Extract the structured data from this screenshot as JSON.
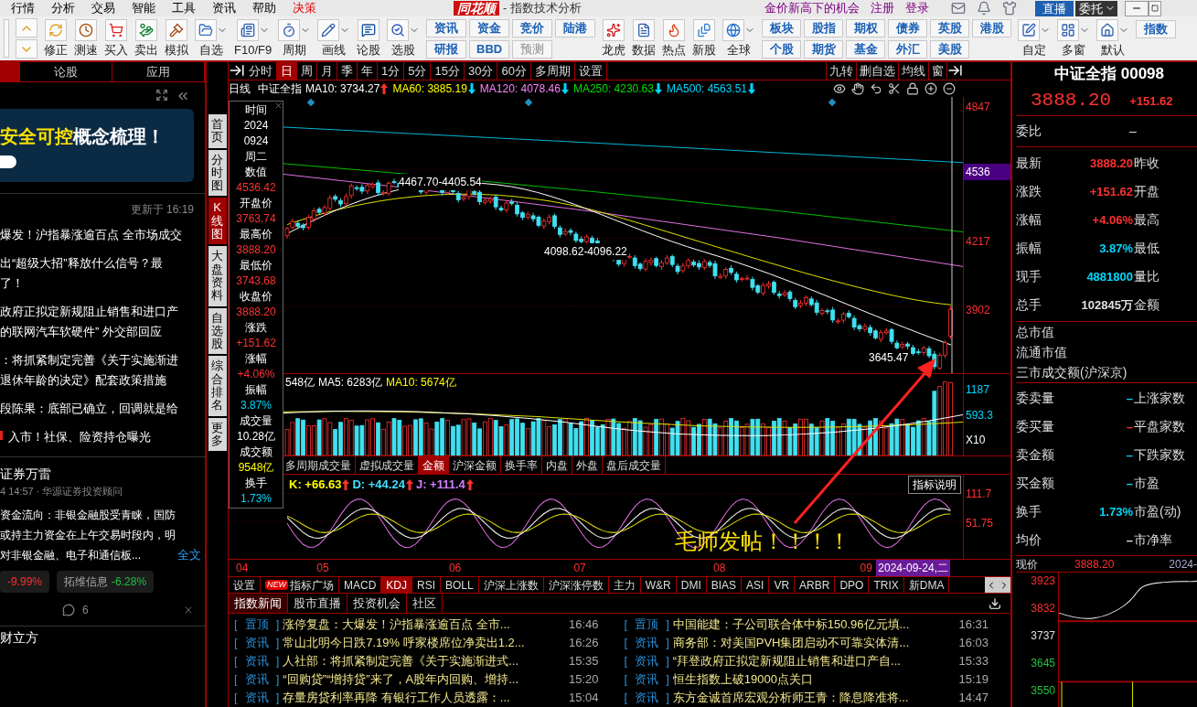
{
  "menu_bar": {
    "menus": [
      {
        "label": "行情",
        "highlight": false
      },
      {
        "label": "分析",
        "highlight": false
      },
      {
        "label": "交易",
        "highlight": false
      },
      {
        "label": "智能",
        "highlight": false
      },
      {
        "label": "工具",
        "highlight": false
      },
      {
        "label": "资讯",
        "highlight": false
      },
      {
        "label": "帮助",
        "highlight": false
      },
      {
        "label": "决策",
        "highlight": true
      }
    ],
    "logo": "同花顺",
    "window_title": "- 指数技术分析",
    "promo": "金价新高下的机会",
    "links": [
      "注册",
      "登录"
    ],
    "buttons": [
      {
        "label": "直播",
        "kind": "live"
      },
      {
        "label": "委托",
        "kind": "trade"
      }
    ]
  },
  "toolbar": {
    "tools": [
      {
        "label": "修正",
        "has_menu": false
      },
      {
        "label": "测速",
        "has_menu": false
      },
      {
        "label": "买入",
        "has_menu": false
      },
      {
        "label": "卖出",
        "has_menu": false
      },
      {
        "label": "模拟",
        "has_menu": false
      },
      {
        "label": "自选",
        "has_menu": true
      },
      {
        "label": "F10/F9",
        "has_menu": true
      },
      {
        "label": "周期",
        "has_menu": true
      },
      {
        "label": "画线",
        "has_menu": true
      },
      {
        "label": "论股",
        "has_menu": false
      },
      {
        "label": "选股",
        "has_menu": true
      }
    ],
    "grid_a": [
      {
        "label": "资讯",
        "disabled": false
      },
      {
        "label": "资金",
        "disabled": false
      },
      {
        "label": "竞价",
        "disabled": false
      },
      {
        "label": "陆港",
        "disabled": false
      },
      {
        "label": "研报",
        "disabled": false
      },
      {
        "label": "BBD",
        "disabled": false
      },
      {
        "label": "预测",
        "disabled": true
      }
    ],
    "markets": [
      {
        "label": "龙虎",
        "has_menu": false
      },
      {
        "label": "数据",
        "has_menu": false
      },
      {
        "label": "热点",
        "has_menu": false
      },
      {
        "label": "新股",
        "has_menu": false
      },
      {
        "label": "全球",
        "has_menu": true
      }
    ],
    "grid_b": [
      {
        "label": "板块",
        "disabled": false
      },
      {
        "label": "股指",
        "disabled": false
      },
      {
        "label": "期权",
        "disabled": false
      },
      {
        "label": "债券",
        "disabled": false
      },
      {
        "label": "英股",
        "disabled": false
      },
      {
        "label": "港股",
        "disabled": false
      },
      {
        "label": "个股",
        "disabled": false
      },
      {
        "label": "期货",
        "disabled": false
      },
      {
        "label": "基金",
        "disabled": false
      },
      {
        "label": "外汇",
        "disabled": false
      },
      {
        "label": "美股",
        "disabled": false
      }
    ],
    "layouts": [
      {
        "label": "自定",
        "has_menu": true
      },
      {
        "label": "多窗",
        "has_menu": true
      },
      {
        "label": "默认",
        "has_menu": true
      }
    ],
    "edge_button": "指数"
  },
  "left_panel": {
    "tabs": [
      {
        "selected": true
      },
      {
        "label": "论股",
        "selected": false
      },
      {
        "label": "应用",
        "selected": false
      }
    ],
    "banner": {
      "highlight": "安全可控",
      "rest": "概念梳理！"
    },
    "updated": "更新于 16:19",
    "headlines": [
      {
        "lines": [
          "爆发！沪指暴涨逾百点 全市场成交"
        ],
        "marked": false
      },
      {
        "lines": [
          "出“超级大招”释放什么信号？最",
          "了！"
        ],
        "marked": false
      },
      {
        "lines": [
          "政府正拟定新规阻止销售和进口产",
          "的联网汽车软硬件” 外交部回应"
        ],
        "marked": false
      },
      {
        "lines": [
          "：将抓紧制定完善《关于实施渐进",
          "退休年龄的决定》配套政策措施"
        ],
        "marked": false
      },
      {
        "lines": [
          "段陈果：底部已确立，回调就是给"
        ],
        "marked": false
      },
      {
        "lines": [
          "入市！社保、险资持仓曝光"
        ],
        "marked": true
      }
    ],
    "post": {
      "author": "证券万雷",
      "meta": "4 14:57 · 华源证券投资顾问",
      "lines": [
        "资金流向：非银金融股受青睐，国防",
        "或持主力资金在上午交易时段内，明",
        "对非银金融、电子和通信板..."
      ],
      "link": "全文",
      "tags": [
        {
          "change": "-9.99%",
          "color": "#ff3030"
        },
        {
          "name": "拓维信息",
          "change": "-6.28%",
          "color": "#20c040"
        }
      ],
      "comments": "6"
    },
    "next_author": "财立方",
    "side_tabs": [
      {
        "label": "首页",
        "selected": false
      },
      {
        "label": "分时图",
        "selected": false
      },
      {
        "label": "K线图",
        "selected": true
      },
      {
        "label": "大盘资料",
        "selected": false
      },
      {
        "label": "自选股",
        "selected": false
      },
      {
        "label": "综合排名",
        "selected": false
      },
      {
        "label": "更多",
        "selected": false
      }
    ]
  },
  "chart": {
    "period_tabs": [
      {
        "label": "分时",
        "selected": false
      },
      {
        "label": "日",
        "selected": true
      },
      {
        "label": "周",
        "selected": false
      },
      {
        "label": "月",
        "selected": false
      },
      {
        "label": "季",
        "selected": false
      },
      {
        "label": "年",
        "selected": false
      },
      {
        "label": "1分",
        "selected": false
      },
      {
        "label": "5分",
        "selected": false
      },
      {
        "label": "15分",
        "selected": false
      },
      {
        "label": "30分",
        "selected": false
      },
      {
        "label": "60分",
        "selected": false
      },
      {
        "label": "多周期",
        "selected": false
      },
      {
        "label": "设置",
        "selected": false
      }
    ],
    "right_tabs": [
      "九转",
      "删自选",
      "均线",
      "窗"
    ],
    "ma_legend": {
      "period": "日线",
      "name": "中证全指",
      "items": [
        {
          "label": "MA10: 3734.27",
          "color": "#ffffff",
          "arrow": {
            "rising": true,
            "color": "#ff3030"
          }
        },
        {
          "label": "MA60: 3885.19",
          "color": "#ffff00",
          "arrow": {
            "rising": false,
            "color": "#00d8ff"
          }
        },
        {
          "label": "MA120: 4078.46",
          "color": "#ff80ff",
          "arrow": {
            "rising": false,
            "color": "#00d8ff"
          }
        },
        {
          "label": "MA250: 4230.63",
          "color": "#00e000",
          "arrow": {
            "rising": false,
            "color": "#00d8ff"
          }
        },
        {
          "label": "MA500: 4563.51",
          "color": "#00d8ff",
          "arrow": {
            "rising": false,
            "color": "#00d8ff"
          }
        }
      ]
    },
    "price_axis": [
      {
        "label": "4847",
        "highlight": false
      },
      {
        "label": "4536",
        "highlight": true
      },
      {
        "label": "4217",
        "highlight": false
      },
      {
        "label": "3902",
        "highlight": false
      }
    ],
    "notes": [
      "4467.70-4405.54",
      "4098.62-4096.22",
      "3645.47"
    ],
    "info_box": [
      {
        "label": "时间",
        "values": [
          "2024",
          "0924",
          "周二"
        ],
        "color": "#ffffff"
      },
      {
        "label": "数值",
        "values": [
          "4536.42"
        ],
        "color": "#ff3030"
      },
      {
        "label": "开盘价",
        "values": [
          "3763.74"
        ],
        "color": "#ff3030"
      },
      {
        "label": "最高价",
        "values": [
          "3888.20"
        ],
        "color": "#ff3030"
      },
      {
        "label": "最低价",
        "values": [
          "3743.68"
        ],
        "color": "#ff3030"
      },
      {
        "label": "收盘价",
        "values": [
          "3888.20"
        ],
        "color": "#ff3030"
      },
      {
        "label": "涨跌",
        "values": [
          "+151.62"
        ],
        "color": "#ff3030"
      },
      {
        "label": "涨幅",
        "values": [
          "+4.06%"
        ],
        "color": "#ff3030"
      },
      {
        "label": "振幅",
        "values": [
          "3.87%"
        ],
        "color": "#00d8ff"
      },
      {
        "label": "成交量",
        "values": [
          "10.28亿"
        ],
        "color": "#ffffff"
      },
      {
        "label": "成交额",
        "values": [
          "9548亿"
        ],
        "color": "#ffff00"
      },
      {
        "label": "换手",
        "values": [
          "1.73%"
        ],
        "color": "#00d8ff"
      }
    ],
    "volume": {
      "legend": [
        {
          "label": "548亿",
          "color": "#ffffff"
        },
        {
          "label": "MA5: 6283亿",
          "color": "#ffffff"
        },
        {
          "label": "MA10: 5674亿",
          "color": "#ffff00"
        }
      ],
      "axis": [
        "1187",
        "593.3",
        "X10"
      ]
    },
    "volume_tabs": [
      {
        "label": "多周期成交量",
        "selected": false
      },
      {
        "label": "虚拟成交量",
        "selected": false
      },
      {
        "label": "金额",
        "selected": true
      },
      {
        "label": "沪深金额",
        "selected": false
      },
      {
        "label": "换手率",
        "selected": false
      },
      {
        "label": "内盘",
        "selected": false
      },
      {
        "label": "外盘",
        "selected": false
      },
      {
        "label": "盘后成交量",
        "selected": false
      }
    ],
    "kdj": {
      "legend": [
        {
          "label": "K: +66.63",
          "color": "#ffff00",
          "arrow": {
            "rising": true,
            "color": "#ff3030"
          }
        },
        {
          "label": "D: +44.24",
          "color": "#40e0ff",
          "arrow": {
            "rising": true,
            "color": "#ff3030"
          }
        },
        {
          "label": "J: +111.4",
          "color": "#d080ff",
          "arrow": {
            "rising": true,
            "color": "#ff3030"
          }
        }
      ],
      "help_button": "指标说明",
      "axis": [
        "111.7",
        "51.75"
      ]
    },
    "date_axis": [
      "04",
      "05",
      "06",
      "07",
      "08",
      "09"
    ],
    "cursor_date": "2024-09-24,二",
    "annotation": "毛师发帖！！！！"
  },
  "indicator_tabs": [
    {
      "label": "设置",
      "selected": false
    },
    {
      "label": "指标广场",
      "badge": "NEW",
      "selected": false
    },
    {
      "label": "MACD",
      "selected": false
    },
    {
      "label": "KDJ",
      "selected": true
    },
    {
      "label": "RSI",
      "selected": false
    },
    {
      "label": "BOLL",
      "selected": false
    },
    {
      "label": "沪深上涨数",
      "selected": false
    },
    {
      "label": "沪深涨停数",
      "selected": false
    },
    {
      "label": "主力",
      "selected": false
    },
    {
      "label": "W&R",
      "selected": false
    },
    {
      "label": "DMI",
      "selected": false
    },
    {
      "label": "BIAS",
      "selected": false
    },
    {
      "label": "ASI",
      "selected": false
    },
    {
      "label": "VR",
      "selected": false
    },
    {
      "label": "ARBR",
      "selected": false
    },
    {
      "label": "DPO",
      "selected": false
    },
    {
      "label": "TRIX",
      "selected": false
    },
    {
      "label": "新DMA",
      "selected": false
    }
  ],
  "news_tabs": [
    {
      "label": "指数新闻",
      "selected": true
    },
    {
      "label": "股市直播",
      "selected": false
    },
    {
      "label": "投资机会",
      "selected": false
    },
    {
      "label": "社区",
      "selected": false
    }
  ],
  "news_brackets": [
    "[",
    "]"
  ],
  "news": [
    {
      "tag": "置顶",
      "title": "涨停复盘：大爆发！沪指暴涨逾百点 全市...",
      "time": "16:46"
    },
    {
      "tag": "置顶",
      "title": "中国能建：子公司联合体中标150.96亿元填...",
      "time": "16:31"
    },
    {
      "tag": "资讯",
      "title": "常山北明今日跌7.19% 呼家楼席位净卖出1.2...",
      "time": "16:26"
    },
    {
      "tag": "资讯",
      "title": "商务部：对美国PVH集团启动不可靠实体清...",
      "time": "16:03"
    },
    {
      "tag": "资讯",
      "title": "人社部：将抓紧制定完善《关于实施渐进式...",
      "time": "15:35"
    },
    {
      "tag": "资讯",
      "title": "“拜登政府正拟定新规阻止销售和进口产自...",
      "time": "15:33"
    },
    {
      "tag": "资讯",
      "title": "“回购贷”“增持贷”来了，A股年内回购、增持...",
      "time": "15:20"
    },
    {
      "tag": "资讯",
      "title": "恒生指数上破19000点关口",
      "time": "15:19"
    },
    {
      "tag": "资讯",
      "title": "存量房贷利率再降 有银行工作人员透露：...",
      "time": "15:04"
    },
    {
      "tag": "资讯",
      "title": "东方金诚首席宏观分析师王青：降息降准将...",
      "time": "14:47"
    }
  ],
  "quote_panel": {
    "title": "中证全指 00098",
    "price": "3888.20",
    "change": "+151.62",
    "ratio_label": "委比",
    "ratio_value": "–",
    "stats": [
      {
        "label": "最新",
        "value": "3888.20",
        "color": "#ff3030",
        "right": "昨收"
      },
      {
        "label": "涨跌",
        "value": "+151.62",
        "color": "#ff3030",
        "right": "开盘"
      },
      {
        "label": "涨幅",
        "value": "+4.06%",
        "color": "#ff3030",
        "right": "最高"
      },
      {
        "label": "振幅",
        "value": "3.87%",
        "color": "#00d8ff",
        "right": "最低"
      },
      {
        "label": "现手",
        "value": "4881800",
        "color": "#00d8ff",
        "right": "量比"
      },
      {
        "label": "总手",
        "value": "102845万",
        "color": "#e0e0e0",
        "right": "金额"
      }
    ],
    "market": [
      "总市值",
      "流通市值",
      "三市成交额(沪深京)"
    ],
    "orders": [
      {
        "label": "委卖量",
        "value": "–",
        "color": "#00d8ff",
        "right": "上涨家数"
      },
      {
        "label": "委买量",
        "value": "–",
        "color": "#ff3030",
        "right": "平盘家数"
      },
      {
        "label": "卖金额",
        "value": "–",
        "color": "#00d8ff",
        "right": "下跌家数"
      },
      {
        "label": "买金额",
        "value": "–",
        "color": "#00d8ff",
        "right": "市盈"
      },
      {
        "label": "换手",
        "value": "1.73%",
        "color": "#00d8ff",
        "right": "市盈(动)"
      },
      {
        "label": "均价",
        "value": "–",
        "color": "#e0e0e0",
        "right": "市净率"
      }
    ],
    "mini_chart": {
      "label": "现价",
      "price": "3888.20",
      "date": "2024-",
      "axis": [
        {
          "label": "3923",
          "color": "#ff3030"
        },
        {
          "label": "3832",
          "color": "#ff3030"
        },
        {
          "label": "3737",
          "color": "#e0e0e0"
        },
        {
          "label": "3645",
          "color": "#20c040"
        },
        {
          "label": "3550",
          "color": "#20c040"
        }
      ]
    }
  }
}
